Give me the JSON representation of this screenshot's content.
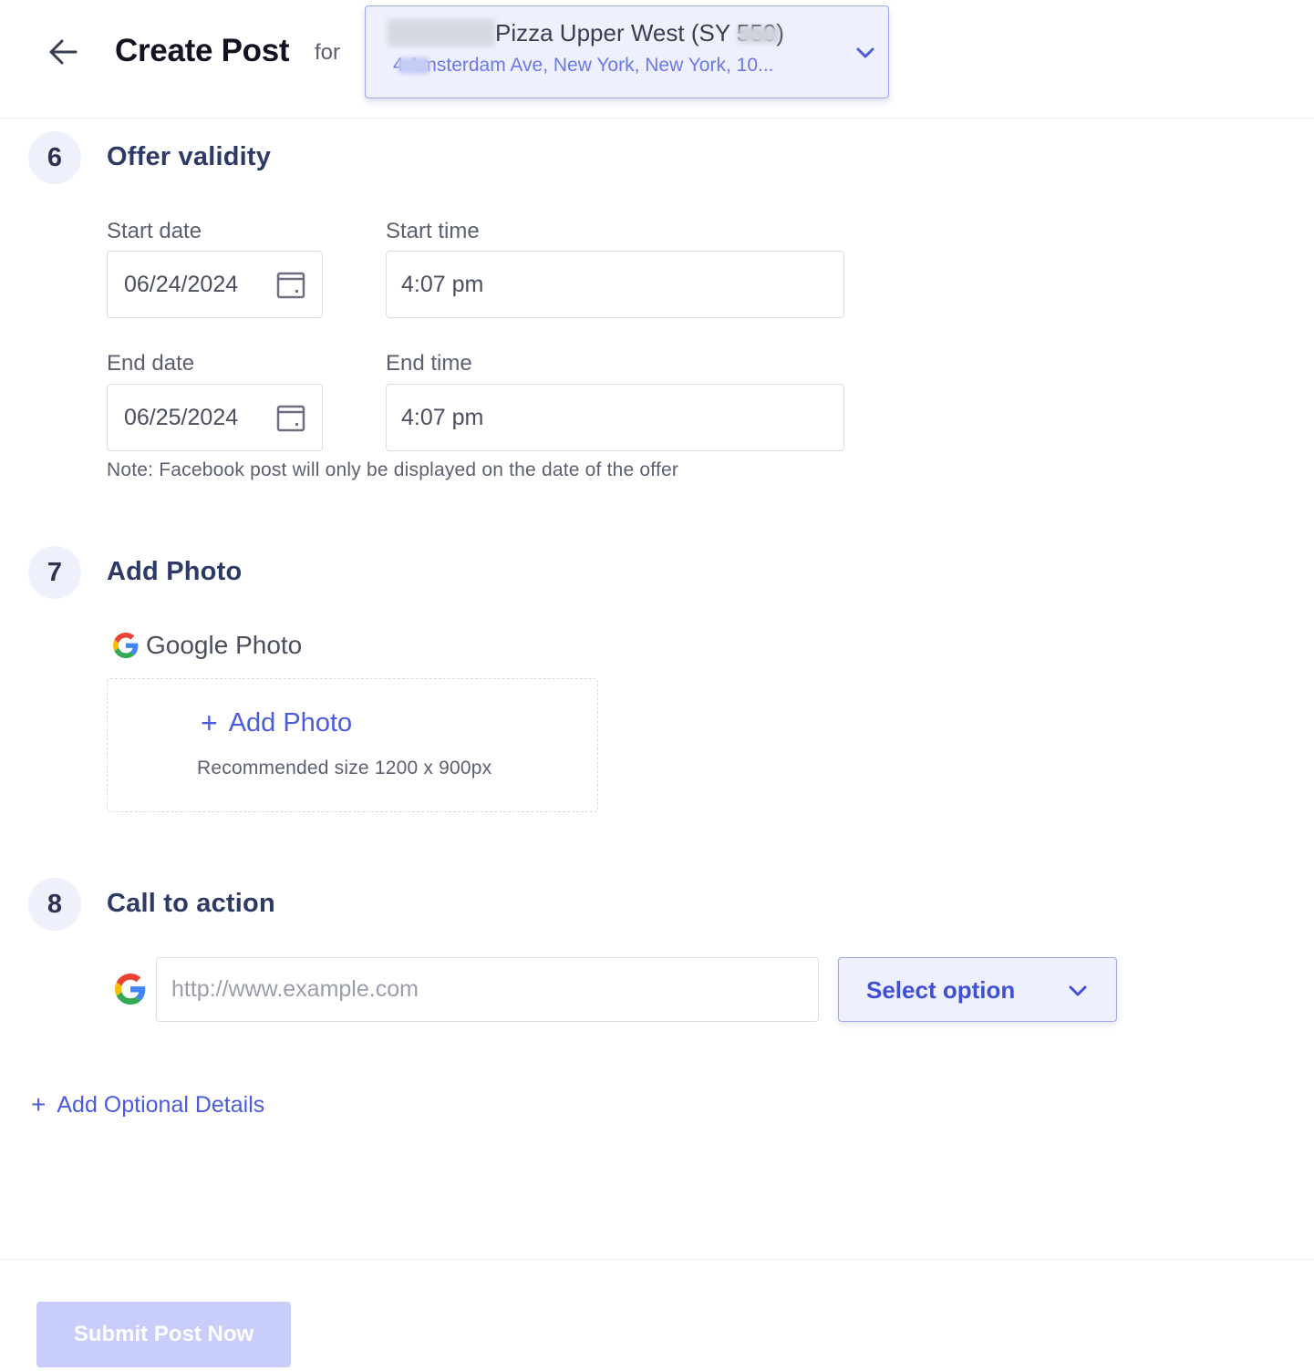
{
  "header": {
    "title": "Create Post",
    "for_label": "for",
    "location": {
      "name": "Pizza Upper West (SY     559)",
      "address": "4    Amsterdam Ave, New York, New York, 10..."
    }
  },
  "sections": {
    "offer_validity": {
      "step": "6",
      "title": "Offer validity",
      "start_date_label": "Start date",
      "start_date": "06/24/2024",
      "start_time_label": "Start time",
      "start_time": "4:07 pm",
      "end_date_label": "End date",
      "end_date": "06/25/2024",
      "end_time_label": "End time",
      "end_time": "4:07 pm",
      "note": "Note: Facebook post will only be displayed on the date of the offer"
    },
    "add_photo": {
      "step": "7",
      "title": "Add Photo",
      "google_photo_label": "Google Photo",
      "add_photo_label": "Add Photo",
      "recommended": "Recommended size 1200 x 900px"
    },
    "call_to_action": {
      "step": "8",
      "title": "Call to action",
      "url_placeholder": "http://www.example.com",
      "select_label": "Select option"
    }
  },
  "add_optional_label": "Add Optional Details",
  "submit_label": "Submit Post Now",
  "colors": {
    "accent": "#4a5bdc",
    "select_bg": "#eef0fd",
    "submit_disabled": "#c8cdfa"
  },
  "icons": [
    "back-arrow-icon",
    "chevron-down-icon",
    "calendar-icon",
    "google-icon",
    "plus-icon"
  ]
}
